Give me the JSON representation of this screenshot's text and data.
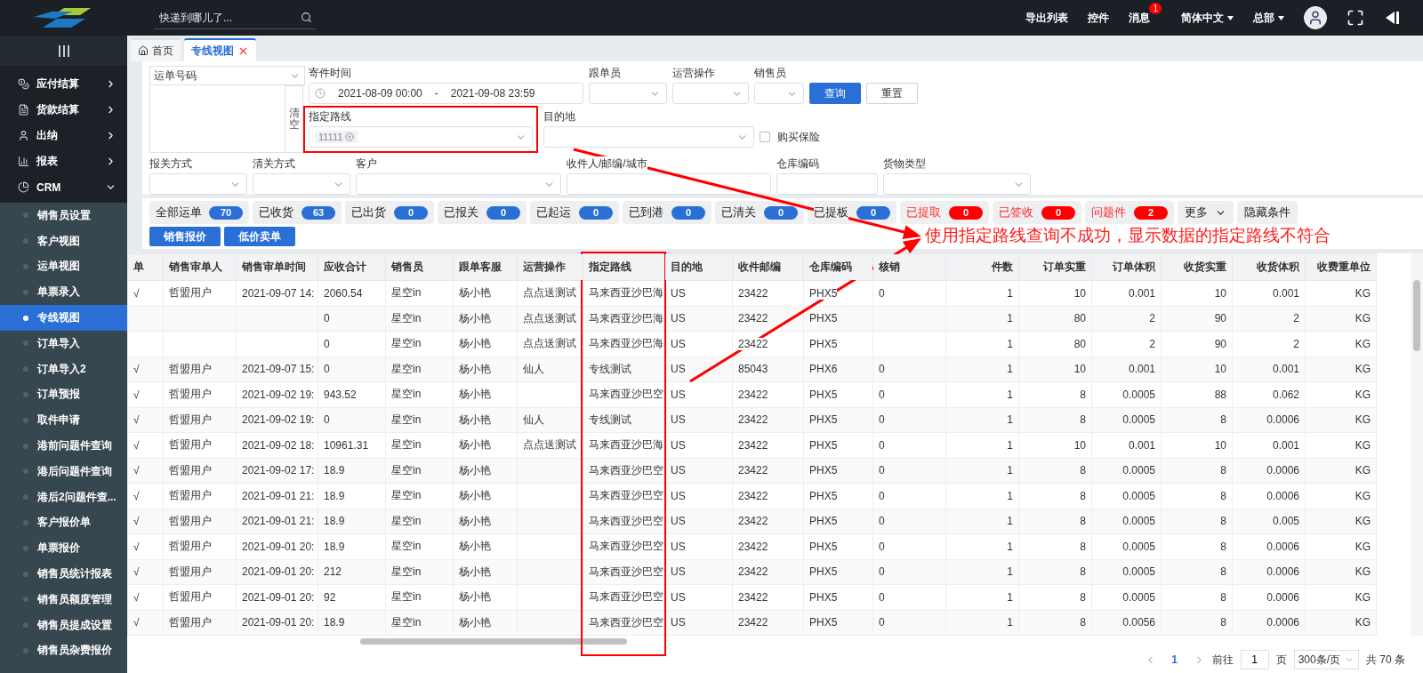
{
  "topbar": {
    "search": {
      "placeholder": "快递到哪儿了..."
    },
    "actions": [
      {
        "label": "导出列表",
        "kind": "link"
      },
      {
        "label": "控件",
        "kind": "link"
      },
      {
        "label": "消息",
        "kind": "badge",
        "badge": "1"
      },
      {
        "label": "简体中文",
        "kind": "dropdown"
      },
      {
        "label": "总部",
        "kind": "dropdown"
      }
    ]
  },
  "sidebar": {
    "items": [
      {
        "label": "应付结算",
        "expanded": false
      },
      {
        "label": "货款结算",
        "expanded": false
      },
      {
        "label": "出纳",
        "expanded": false
      },
      {
        "label": "报表",
        "expanded": false
      },
      {
        "label": "CRM",
        "expanded": true,
        "children": [
          {
            "label": "销售员设置",
            "selected": false
          },
          {
            "label": "客户视图",
            "selected": false
          },
          {
            "label": "运单视图",
            "selected": false
          },
          {
            "label": "单票录入",
            "selected": false
          },
          {
            "label": "专线视图",
            "selected": true
          },
          {
            "label": "订单导入",
            "selected": false
          },
          {
            "label": "订单导入2",
            "selected": false
          },
          {
            "label": "订单预报",
            "selected": false
          },
          {
            "label": "取件申请",
            "selected": false
          },
          {
            "label": "港前问题件查询",
            "selected": false
          },
          {
            "label": "港后问题件查询",
            "selected": false
          },
          {
            "label": "港后2问题件查...",
            "selected": false
          },
          {
            "label": "客户报价单",
            "selected": false
          },
          {
            "label": "单票报价",
            "selected": false
          },
          {
            "label": "销售员统计报表",
            "selected": false
          },
          {
            "label": "销售员额度管理",
            "selected": false
          },
          {
            "label": "销售员提成设置",
            "selected": false
          },
          {
            "label": "销售员杂费报价",
            "selected": false
          }
        ]
      }
    ]
  },
  "tabs": [
    {
      "label": "首页",
      "selected": false,
      "kind": "home"
    },
    {
      "label": "专线视图",
      "selected": true,
      "kind": "closable"
    }
  ],
  "filters": {
    "waybill": {
      "label": "运单号码"
    },
    "clear_button": "清空",
    "ship_time": {
      "label": "寄件时间",
      "start": "2021-08-09 00:00",
      "separator": "-",
      "end": "2021-09-08 23:59"
    },
    "selects": [
      {
        "label": "跟单员"
      },
      {
        "label": "运营操作"
      },
      {
        "label": "销售员"
      }
    ],
    "search_button": "查询",
    "reset_button": "重置",
    "route": {
      "label": "指定路线",
      "tags": [
        "11111"
      ]
    },
    "destination": {
      "label": "目的地"
    },
    "insurance": {
      "label": "购买保险",
      "checked": false
    },
    "more": [
      {
        "label": "报关方式",
        "kind": "select"
      },
      {
        "label": "清关方式",
        "kind": "select"
      },
      {
        "label": "客户",
        "kind": "select"
      },
      {
        "label": "收件人/邮编/城市",
        "kind": "input"
      },
      {
        "label": "仓库编码",
        "kind": "input"
      },
      {
        "label": "货物类型",
        "kind": "select"
      }
    ]
  },
  "status_tabs": [
    {
      "label": "全部运单",
      "count": "70",
      "alert": false,
      "color": "#2a6fd6"
    },
    {
      "label": "已收货",
      "count": "63",
      "alert": false,
      "color": "#2a6fd6"
    },
    {
      "label": "已出货",
      "count": "0",
      "alert": false,
      "color": "#2a6fd6"
    },
    {
      "label": "已报关",
      "count": "0",
      "alert": false,
      "color": "#2a6fd6"
    },
    {
      "label": "已起运",
      "count": "0",
      "alert": false,
      "color": "#2a6fd6"
    },
    {
      "label": "已到港",
      "count": "0",
      "alert": false,
      "color": "#2a6fd6"
    },
    {
      "label": "已清关",
      "count": "0",
      "alert": false,
      "color": "#2a6fd6"
    },
    {
      "label": "已提板",
      "count": "0",
      "alert": false,
      "color": "#2a6fd6"
    },
    {
      "label": "已提取",
      "count": "0",
      "alert": true,
      "color": "#ff0000"
    },
    {
      "label": "已签收",
      "count": "0",
      "alert": true,
      "color": "#ff0000"
    },
    {
      "label": "问题件",
      "count": "2",
      "alert": true,
      "color": "#ff0000"
    }
  ],
  "more_button": "更多",
  "hide_button": "隐藏条件",
  "action_buttons": [
    "销售报价",
    "低价卖单"
  ],
  "table": {
    "columns": [
      "单",
      "销售审单人",
      "销售审单时间",
      "应收合计",
      "销售员",
      "跟单客服",
      "运营操作",
      "指定路线",
      "目的地",
      "收件邮编",
      "仓库编码",
      "核销",
      "件数",
      "订单实重",
      "订单体积",
      "收货实重",
      "收货体积",
      "收费重单位"
    ],
    "rows": [
      [
        "√",
        "哲盟用户",
        "2021-09-07 14:",
        "2060.54",
        "星空in",
        "杨小艳",
        "点点送测试",
        "马来西亚沙巴海",
        "US",
        "23422",
        "PHX5",
        "0",
        "1",
        "10",
        "0.001",
        "10",
        "0.001",
        "KG"
      ],
      [
        null,
        null,
        null,
        "0",
        "星空in",
        "杨小艳",
        "点点送测试",
        "马来西亚沙巴海",
        "US",
        "23422",
        "PHX5",
        null,
        "1",
        "80",
        "2",
        "90",
        "2",
        "KG"
      ],
      [
        null,
        null,
        null,
        "0",
        "星空in",
        "杨小艳",
        "点点送测试",
        "马来西亚沙巴海",
        "US",
        "23422",
        "PHX5",
        null,
        "1",
        "80",
        "2",
        "90",
        "2",
        "KG"
      ],
      [
        "√",
        "哲盟用户",
        "2021-09-07 15:",
        "0",
        "星空in",
        "杨小艳",
        "仙人",
        "专线测试",
        "US",
        "85043",
        "PHX6",
        "0",
        "1",
        "10",
        "0.001",
        "10",
        "0.001",
        "KG"
      ],
      [
        "√",
        "哲盟用户",
        "2021-09-02 19:",
        "943.52",
        "星空in",
        "杨小艳",
        null,
        "马来西亚沙巴空",
        "US",
        "23422",
        "PHX5",
        "0",
        "1",
        "8",
        "0.0005",
        "88",
        "0.062",
        "KG"
      ],
      [
        "√",
        "哲盟用户",
        "2021-09-02 19:",
        "0",
        "星空in",
        "杨小艳",
        "仙人",
        "专线测试",
        "US",
        "23422",
        "PHX5",
        "0",
        "1",
        "8",
        "0.0005",
        "8",
        "0.0006",
        "KG"
      ],
      [
        "√",
        "哲盟用户",
        "2021-09-02 18:",
        "10961.31",
        "星空in",
        "杨小艳",
        "点点送测试",
        "马来西亚沙巴海",
        "US",
        "23422",
        "PHX5",
        "0",
        "1",
        "10",
        "0.001",
        "10",
        "0.001",
        "KG"
      ],
      [
        "√",
        "哲盟用户",
        "2021-09-02 17:",
        "18.9",
        "星空in",
        "杨小艳",
        null,
        "马来西亚沙巴空",
        "US",
        "23422",
        "PHX5",
        "0",
        "1",
        "8",
        "0.0005",
        "8",
        "0.0006",
        "KG"
      ],
      [
        "√",
        "哲盟用户",
        "2021-09-01 21:",
        "18.9",
        "星空in",
        "杨小艳",
        null,
        "马来西亚沙巴空",
        "US",
        "23422",
        "PHX5",
        "0",
        "1",
        "8",
        "0.0005",
        "8",
        "0.0006",
        "KG"
      ],
      [
        "√",
        "哲盟用户",
        "2021-09-01 21:",
        "18.9",
        "星空in",
        "杨小艳",
        null,
        "马来西亚沙巴空",
        "US",
        "23422",
        "PHX5",
        "0",
        "1",
        "8",
        "0.0005",
        "8",
        "0.005",
        "KG"
      ],
      [
        "√",
        "哲盟用户",
        "2021-09-01 20:",
        "18.9",
        "星空in",
        "杨小艳",
        null,
        "马来西亚沙巴空",
        "US",
        "23422",
        "PHX5",
        "0",
        "1",
        "8",
        "0.0005",
        "8",
        "0.0006",
        "KG"
      ],
      [
        "√",
        "哲盟用户",
        "2021-09-01 20:",
        "212",
        "星空in",
        "杨小艳",
        null,
        "马来西亚沙巴空",
        "US",
        "23422",
        "PHX5",
        "0",
        "1",
        "8",
        "0.0005",
        "8",
        "0.0006",
        "KG"
      ],
      [
        "√",
        "哲盟用户",
        "2021-09-01 20:",
        "92",
        "星空in",
        "杨小艳",
        null,
        "马来西亚沙巴空",
        "US",
        "23422",
        "PHX5",
        "0",
        "1",
        "8",
        "0.0005",
        "8",
        "0.0006",
        "KG"
      ],
      [
        "√",
        "哲盟用户",
        "2021-09-01 20:",
        "18.9",
        "星空in",
        "杨小艳",
        null,
        "马来西亚沙巴空",
        "US",
        "23422",
        "PHX5",
        "0",
        "1",
        "8",
        "0.0056",
        "8",
        "0.0006",
        "KG"
      ]
    ]
  },
  "pagination": {
    "pages": [
      {
        "label": "1",
        "selected": true
      }
    ],
    "goto_label": "前往",
    "goto_value": "1",
    "page_unit": "页",
    "page_size": "300条/页",
    "total": "共 70 条"
  },
  "annotation": {
    "text": "使用指定路线查询不成功，显示数据的指定路线不符合"
  }
}
